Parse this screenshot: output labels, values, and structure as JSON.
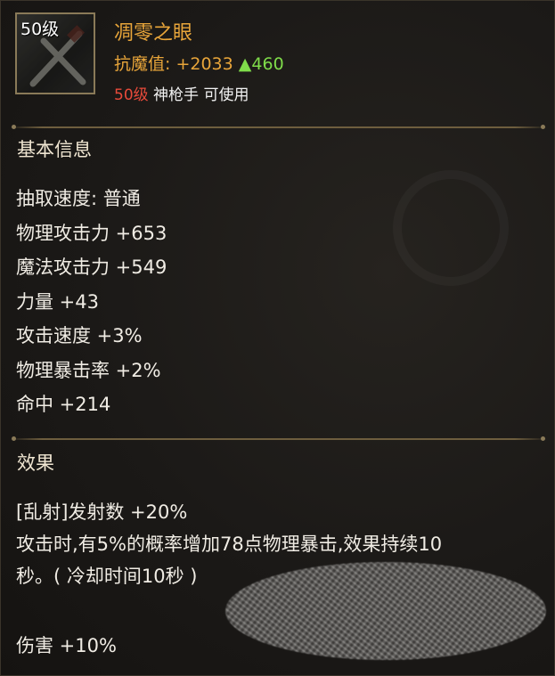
{
  "item": {
    "level_badge": "50级",
    "name": "凋零之眼",
    "resist_label": "抗魔值:",
    "resist_value": "+2033",
    "resist_increase": "▲460",
    "required_level": "50级",
    "required_class": "神枪手 可使用",
    "icon": "crossed-guns-icon"
  },
  "basic_info": {
    "title": "基本信息",
    "stats": [
      "抽取速度: 普通",
      "物理攻击力 +653",
      "魔法攻击力 +549",
      "力量 +43",
      "攻击速度 +3%",
      "物理暴击率 +2%",
      "命中 +214"
    ]
  },
  "effects": {
    "title": "效果",
    "lines": [
      "[乱射]发射数 +20%",
      "攻击时,有5%的概率增加78点物理暴击,效果持续10",
      "秒。( 冷却时间10秒 )",
      "",
      "伤害 +10%"
    ]
  },
  "colors": {
    "name": "#e8a53a",
    "increase": "#7fdc4a",
    "required_level": "#e84a3a",
    "divider": "#6e5e3e"
  }
}
